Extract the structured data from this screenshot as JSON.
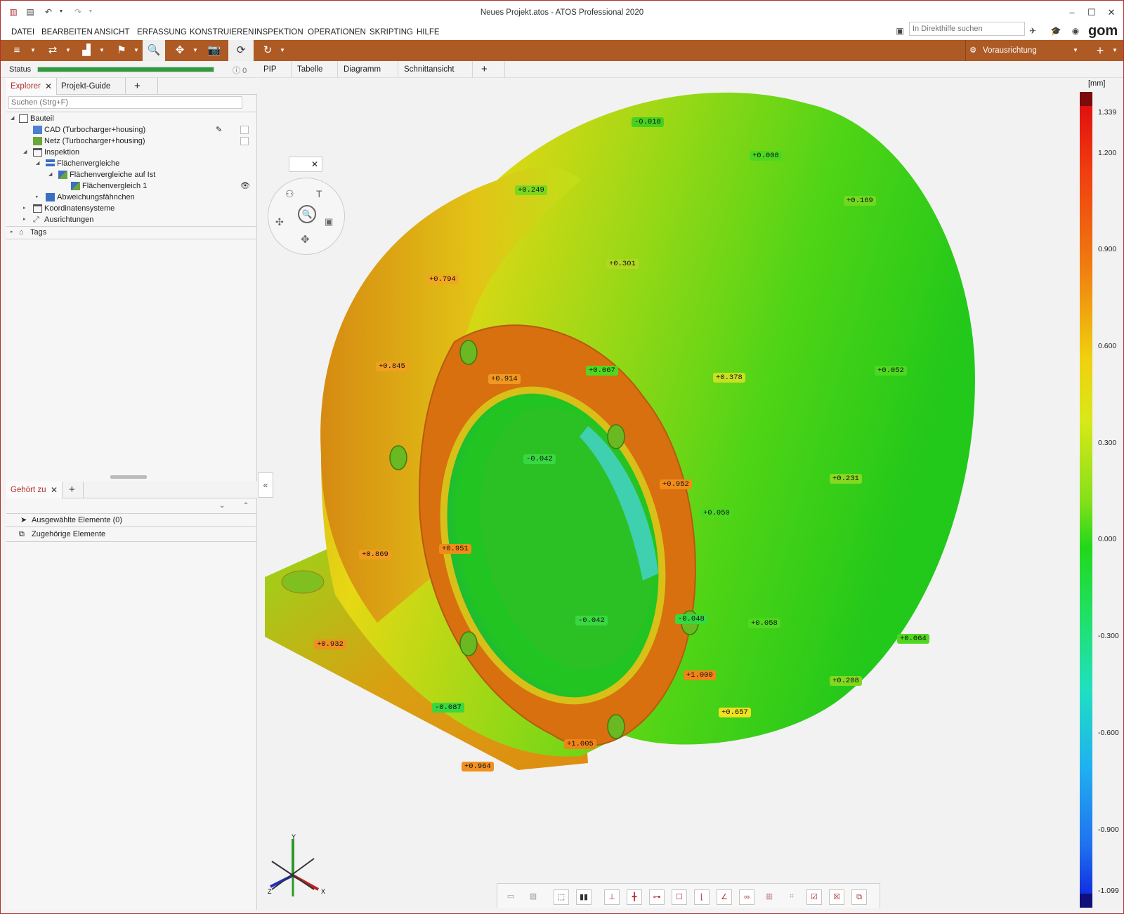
{
  "window": {
    "title": "Neues Projekt.atos - ATOS Professional 2020"
  },
  "menu": [
    "DATEI",
    "BEARBEITEN",
    "ANSICHT",
    "ERFASSUNG",
    "KONSTRUIEREN",
    "INSPEKTION",
    "OPERATIONEN",
    "SKRIPTING",
    "HILFE"
  ],
  "help": {
    "placeholder": "In Direkthilfe suchen",
    "logo": "gom"
  },
  "toolbar": {
    "alignment_label": "Vorausrichtung",
    "accent": "#ad5a25"
  },
  "status": {
    "label": "Status",
    "progress": 1.0,
    "info_count": "0"
  },
  "explorer": {
    "tabs": [
      "Explorer",
      "Projekt-Guide"
    ],
    "search_placeholder": "Suchen (Strg+F)",
    "tree": [
      "Bauteil",
      "CAD (Turbocharger+housing)",
      "Netz (Turbocharger+housing)",
      "Inspektion",
      "Flächenvergleiche",
      "Flächenvergleiche auf Ist",
      "Flächenvergleich 1",
      "Abweichungsfähnchen",
      "Koordinatensysteme",
      "Ausrichtungen",
      "Tags"
    ]
  },
  "belongs": {
    "tab": "Gehört zu",
    "rows": [
      "Ausgewählte Elemente (0)",
      "Zugehörige Elemente"
    ]
  },
  "view_tabs": [
    "PIP",
    "Tabelle",
    "Diagramm",
    "Schnittansicht"
  ],
  "scale": {
    "unit": "[mm]",
    "ticks": [
      "1.339",
      "1.200",
      "0.900",
      "0.600",
      "0.300",
      "0.000",
      "-0.300",
      "-0.600",
      "-0.900",
      "-1.099"
    ]
  },
  "deviations": [
    "-0.018",
    "+0.008",
    "+0.249",
    "+0.169",
    "+0.301",
    "+0.794",
    "+0.845",
    "+0.914",
    "+0.067",
    "+0.378",
    "+0.052",
    "-0.042",
    "+0.952",
    "+0.231",
    "+0.050",
    "+0.869",
    "+0.951",
    "-0.042",
    "-0.048",
    "+0.058",
    "+0.064",
    "+0.932",
    "+1.000",
    "+0.208",
    "-0.087",
    "+0.657",
    "+1.005",
    "+0.964"
  ],
  "axes": {
    "y": "Y",
    "x": "X",
    "z": "Z"
  }
}
